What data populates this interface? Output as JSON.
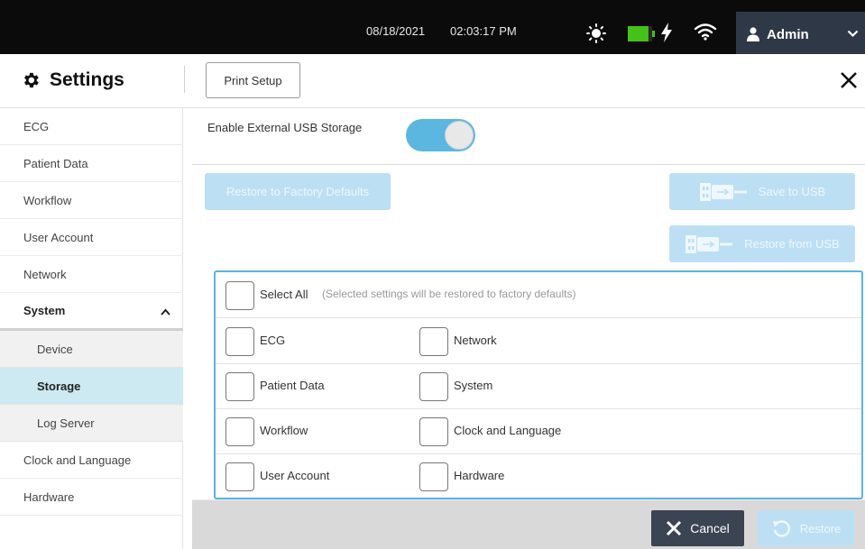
{
  "status_bar": {
    "date": "08/18/2021",
    "time": "02:03:17 PM",
    "user": "Admin",
    "battery_level": 0.85,
    "icons": [
      "brightness-icon",
      "battery-icon",
      "charging-icon",
      "wifi-icon",
      "user-icon",
      "chevron-down-icon"
    ]
  },
  "header": {
    "title": "Settings",
    "print_setup_label": "Print Setup"
  },
  "sidebar": {
    "items": [
      {
        "label": "ECG"
      },
      {
        "label": "Patient Data"
      },
      {
        "label": "Workflow"
      },
      {
        "label": "User Account"
      },
      {
        "label": "Network"
      },
      {
        "label": "System",
        "expanded": true
      },
      {
        "label": "Device"
      },
      {
        "label": "Storage",
        "selected": true
      },
      {
        "label": "Log Server"
      },
      {
        "label": "Clock and Language"
      },
      {
        "label": "Hardware"
      }
    ]
  },
  "main": {
    "usb_storage_label": "Enable External USB Storage",
    "usb_storage_enabled": true,
    "restore_factory_label": "Restore to Factory Defaults",
    "save_usb_label": "Save to USB",
    "restore_usb_label": "Restore from USB",
    "select_all_label": "Select All",
    "select_all_hint": "(Selected settings will be restored to factory defaults)",
    "options_left": [
      "ECG",
      "Patient Data",
      "Workflow",
      "User Account"
    ],
    "options_right": [
      "Network",
      "System",
      "Clock and Language",
      "Hardware"
    ]
  },
  "footer": {
    "cancel_label": "Cancel",
    "restore_label": "Restore"
  },
  "colors": {
    "accent": "#5bb7e0",
    "disabled_button": "#bcdff4",
    "selected_nav": "#cde9f1",
    "dark_button": "#3a4452",
    "top_bar": "#0b0b0b"
  }
}
